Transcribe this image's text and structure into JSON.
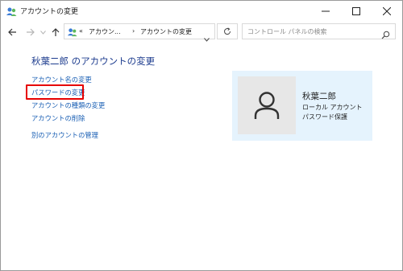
{
  "window": {
    "title": "アカウントの変更",
    "controls": {
      "minimize": "minimize",
      "maximize": "maximize",
      "close": "close"
    }
  },
  "nav": {
    "address": {
      "overflow": "«",
      "crumb1": "アカウン...",
      "sep": "›",
      "crumb2": "アカウントの変更"
    },
    "search_placeholder": "コントロール パネルの検索"
  },
  "main": {
    "heading": "秋葉二郎 のアカウントの変更",
    "links": [
      "アカウント名の変更",
      "パスワードの変更",
      "アカウントの種類の変更",
      "アカウントの削除",
      "別のアカウントの管理"
    ]
  },
  "account": {
    "name": "秋葉二郎",
    "type": "ローカル アカウント",
    "status": "パスワード保護"
  },
  "colors": {
    "heading": "#1e3d8f",
    "link": "#1a5fb4",
    "highlight": "#e60000",
    "card": "#e5f3fd"
  }
}
